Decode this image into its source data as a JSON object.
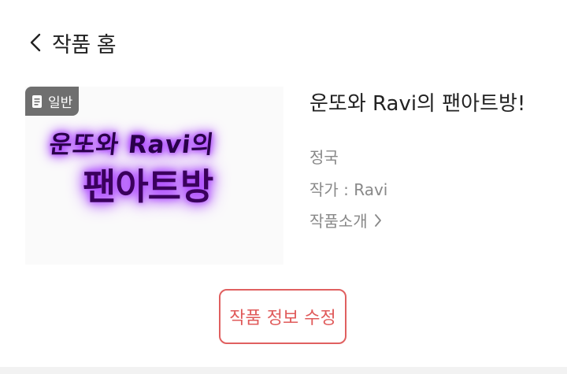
{
  "header": {
    "back_title": "작품 홈"
  },
  "cover": {
    "badge": "일반",
    "art_line1": "운또와 Ravi의",
    "art_line2": "팬아트방"
  },
  "work": {
    "title": "운또와 Ravi의 팬아트방!",
    "genre": "정국",
    "author": "작가 : Ravi",
    "intro_link": "작품소개"
  },
  "actions": {
    "edit_button": "작품 정보 수정"
  },
  "colors": {
    "accent": "#e05a5a",
    "badge_bg": "#6f6f6f",
    "glow": "#9a1bff"
  }
}
